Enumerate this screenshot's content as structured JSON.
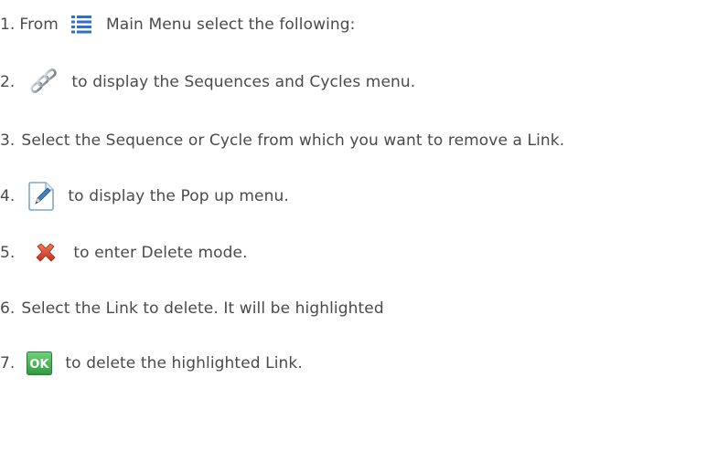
{
  "steps": [
    {
      "number": "1.",
      "pre": "From",
      "icon": "main-menu-list-icon",
      "text": "Main Menu select the following:"
    },
    {
      "number": "2.",
      "icon": "chain-link-icon",
      "text": "to display the Sequences and Cycles menu."
    },
    {
      "number": "3.",
      "text": "Select the Sequence or Cycle from which you want to remove a Link."
    },
    {
      "number": "4.",
      "icon": "edit-pencil-icon",
      "text": "to display the Pop up menu."
    },
    {
      "number": "5.",
      "icon": "delete-x-icon",
      "text": "to enter Delete mode."
    },
    {
      "number": "6.",
      "text": "Select the Link to delete. It will be highlighted"
    },
    {
      "number": "7.",
      "icon": "ok-button-icon",
      "icon_label": "OK",
      "text": "to delete the highlighted Link."
    }
  ],
  "colors": {
    "text": "#4a4a4a",
    "menu_icon_blue": "#2e6fd0",
    "ok_green": "#3aa84a",
    "delete_red": "#d8452a"
  }
}
